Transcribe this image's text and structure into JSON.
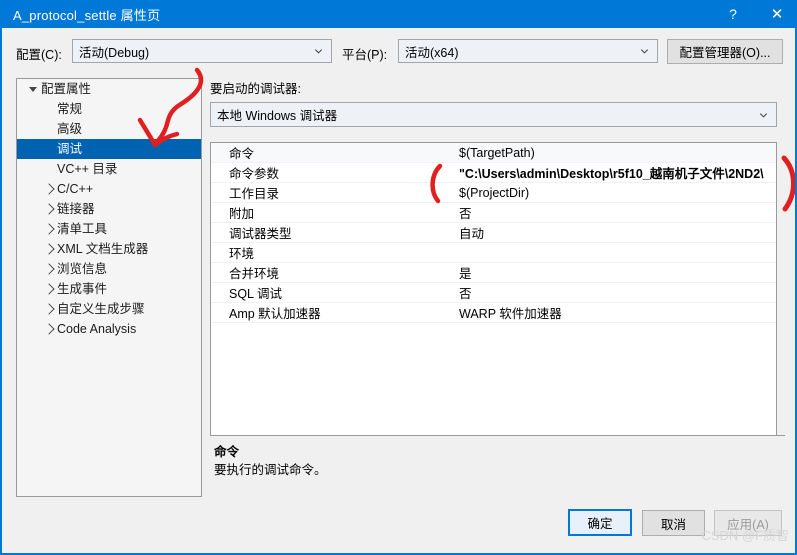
{
  "window": {
    "title": "A_protocol_settle 属性页",
    "help_icon": "?",
    "close_icon": "✕",
    "accent_color": "#0078d7",
    "selection_color": "#0063b1"
  },
  "toolbar": {
    "configuration_label": "配置(C):",
    "configuration_value": "活动(Debug)",
    "platform_label": "平台(P):",
    "platform_value": "活动(x64)",
    "config_manager_label": "配置管理器(O)..."
  },
  "tree": {
    "items": [
      {
        "label": "配置属性",
        "indent": 0,
        "expander": "down",
        "selected": false
      },
      {
        "label": "常规",
        "indent": 1,
        "expander": "none",
        "selected": false
      },
      {
        "label": "高级",
        "indent": 1,
        "expander": "none",
        "selected": false
      },
      {
        "label": "调试",
        "indent": 1,
        "expander": "none",
        "selected": true
      },
      {
        "label": "VC++ 目录",
        "indent": 1,
        "expander": "none",
        "selected": false
      },
      {
        "label": "C/C++",
        "indent": 1,
        "expander": "right",
        "selected": false
      },
      {
        "label": "链接器",
        "indent": 1,
        "expander": "right",
        "selected": false
      },
      {
        "label": "清单工具",
        "indent": 1,
        "expander": "right",
        "selected": false
      },
      {
        "label": "XML 文档生成器",
        "indent": 1,
        "expander": "right",
        "selected": false
      },
      {
        "label": "浏览信息",
        "indent": 1,
        "expander": "right",
        "selected": false
      },
      {
        "label": "生成事件",
        "indent": 1,
        "expander": "right",
        "selected": false
      },
      {
        "label": "自定义生成步骤",
        "indent": 1,
        "expander": "right",
        "selected": false
      },
      {
        "label": "Code Analysis",
        "indent": 1,
        "expander": "right",
        "selected": false
      }
    ]
  },
  "main": {
    "debugger_section_label": "要启动的调试器:",
    "debugger_value": "本地 Windows 调试器",
    "properties": [
      {
        "name": "命令",
        "value": "$(TargetPath)",
        "bold": false
      },
      {
        "name": "命令参数",
        "value": "\"C:\\Users\\admin\\Desktop\\r5f10_越南机子文件\\2ND2\\",
        "bold": true
      },
      {
        "name": "工作目录",
        "value": "$(ProjectDir)",
        "bold": false
      },
      {
        "name": "附加",
        "value": "否",
        "bold": false
      },
      {
        "name": "调试器类型",
        "value": "自动",
        "bold": false
      },
      {
        "name": "环境",
        "value": "",
        "bold": false
      },
      {
        "name": "合并环境",
        "value": "是",
        "bold": false
      },
      {
        "name": "SQL 调试",
        "value": "否",
        "bold": false
      },
      {
        "name": "Amp 默认加速器",
        "value": "WARP 软件加速器",
        "bold": false
      }
    ]
  },
  "description": {
    "title": "命令",
    "body": "要执行的调试命令。"
  },
  "footer": {
    "ok_label": "确定",
    "cancel_label": "取消",
    "apply_label": "应用(A)",
    "watermark": "CSDN @F质智"
  }
}
